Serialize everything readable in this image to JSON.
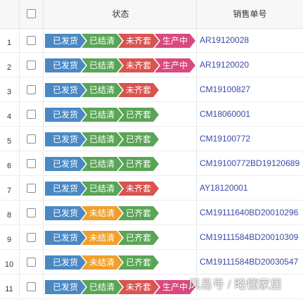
{
  "header": {
    "status_label": "状态",
    "order_label": "销售单号"
  },
  "colors": {
    "shipped": "#4a88c4",
    "settled": "#5aa456",
    "unsettled": "#f0a02a",
    "incomplete": "#d9534f",
    "complete": "#5aa456",
    "producing": "#d9487e",
    "order_link": "#3b4aa8"
  },
  "rows": [
    {
      "num": "1",
      "tags": [
        {
          "text": "已发货",
          "kind": "shipped"
        },
        {
          "text": "已结清",
          "kind": "settled"
        },
        {
          "text": "未齐套",
          "kind": "incomplete"
        },
        {
          "text": "生产中",
          "kind": "producing"
        }
      ],
      "order": "AR19120028"
    },
    {
      "num": "2",
      "tags": [
        {
          "text": "已发货",
          "kind": "shipped"
        },
        {
          "text": "已结清",
          "kind": "settled"
        },
        {
          "text": "未齐套",
          "kind": "incomplete"
        },
        {
          "text": "生产中",
          "kind": "producing"
        }
      ],
      "order": "AR19120020"
    },
    {
      "num": "3",
      "tags": [
        {
          "text": "已发货",
          "kind": "shipped"
        },
        {
          "text": "已结清",
          "kind": "settled"
        },
        {
          "text": "未齐套",
          "kind": "incomplete"
        }
      ],
      "order": "CM19100827"
    },
    {
      "num": "4",
      "tags": [
        {
          "text": "已发货",
          "kind": "shipped"
        },
        {
          "text": "已结清",
          "kind": "settled"
        },
        {
          "text": "已齐套",
          "kind": "complete"
        }
      ],
      "order": "CM18060001"
    },
    {
      "num": "5",
      "tags": [
        {
          "text": "已发货",
          "kind": "shipped"
        },
        {
          "text": "已结清",
          "kind": "settled"
        },
        {
          "text": "已齐套",
          "kind": "complete"
        }
      ],
      "order": "CM19100772"
    },
    {
      "num": "6",
      "tags": [
        {
          "text": "已发货",
          "kind": "shipped"
        },
        {
          "text": "已结清",
          "kind": "settled"
        },
        {
          "text": "已齐套",
          "kind": "complete"
        }
      ],
      "order": "CM19100772BD19120689"
    },
    {
      "num": "7",
      "tags": [
        {
          "text": "已发货",
          "kind": "shipped"
        },
        {
          "text": "已结清",
          "kind": "settled"
        },
        {
          "text": "未齐套",
          "kind": "incomplete"
        }
      ],
      "order": "AY18120001"
    },
    {
      "num": "8",
      "tags": [
        {
          "text": "已发货",
          "kind": "shipped"
        },
        {
          "text": "未结清",
          "kind": "unsettled"
        },
        {
          "text": "已齐套",
          "kind": "complete"
        }
      ],
      "order": "CM19111640BD20010296"
    },
    {
      "num": "9",
      "tags": [
        {
          "text": "已发货",
          "kind": "shipped"
        },
        {
          "text": "未结清",
          "kind": "unsettled"
        },
        {
          "text": "已齐套",
          "kind": "complete"
        }
      ],
      "order": "CM19111584BD20010309"
    },
    {
      "num": "10",
      "tags": [
        {
          "text": "已发货",
          "kind": "shipped"
        },
        {
          "text": "未结清",
          "kind": "unsettled"
        },
        {
          "text": "已齐套",
          "kind": "complete"
        }
      ],
      "order": "CM19111584BD20030547"
    },
    {
      "num": "11",
      "tags": [
        {
          "text": "已发货",
          "kind": "shipped"
        },
        {
          "text": "已结清",
          "kind": "settled"
        },
        {
          "text": "未齐套",
          "kind": "incomplete"
        },
        {
          "text": "生产中",
          "kind": "producing"
        }
      ],
      "order": ""
    }
  ],
  "watermark": "风易号 / 略懂家居"
}
